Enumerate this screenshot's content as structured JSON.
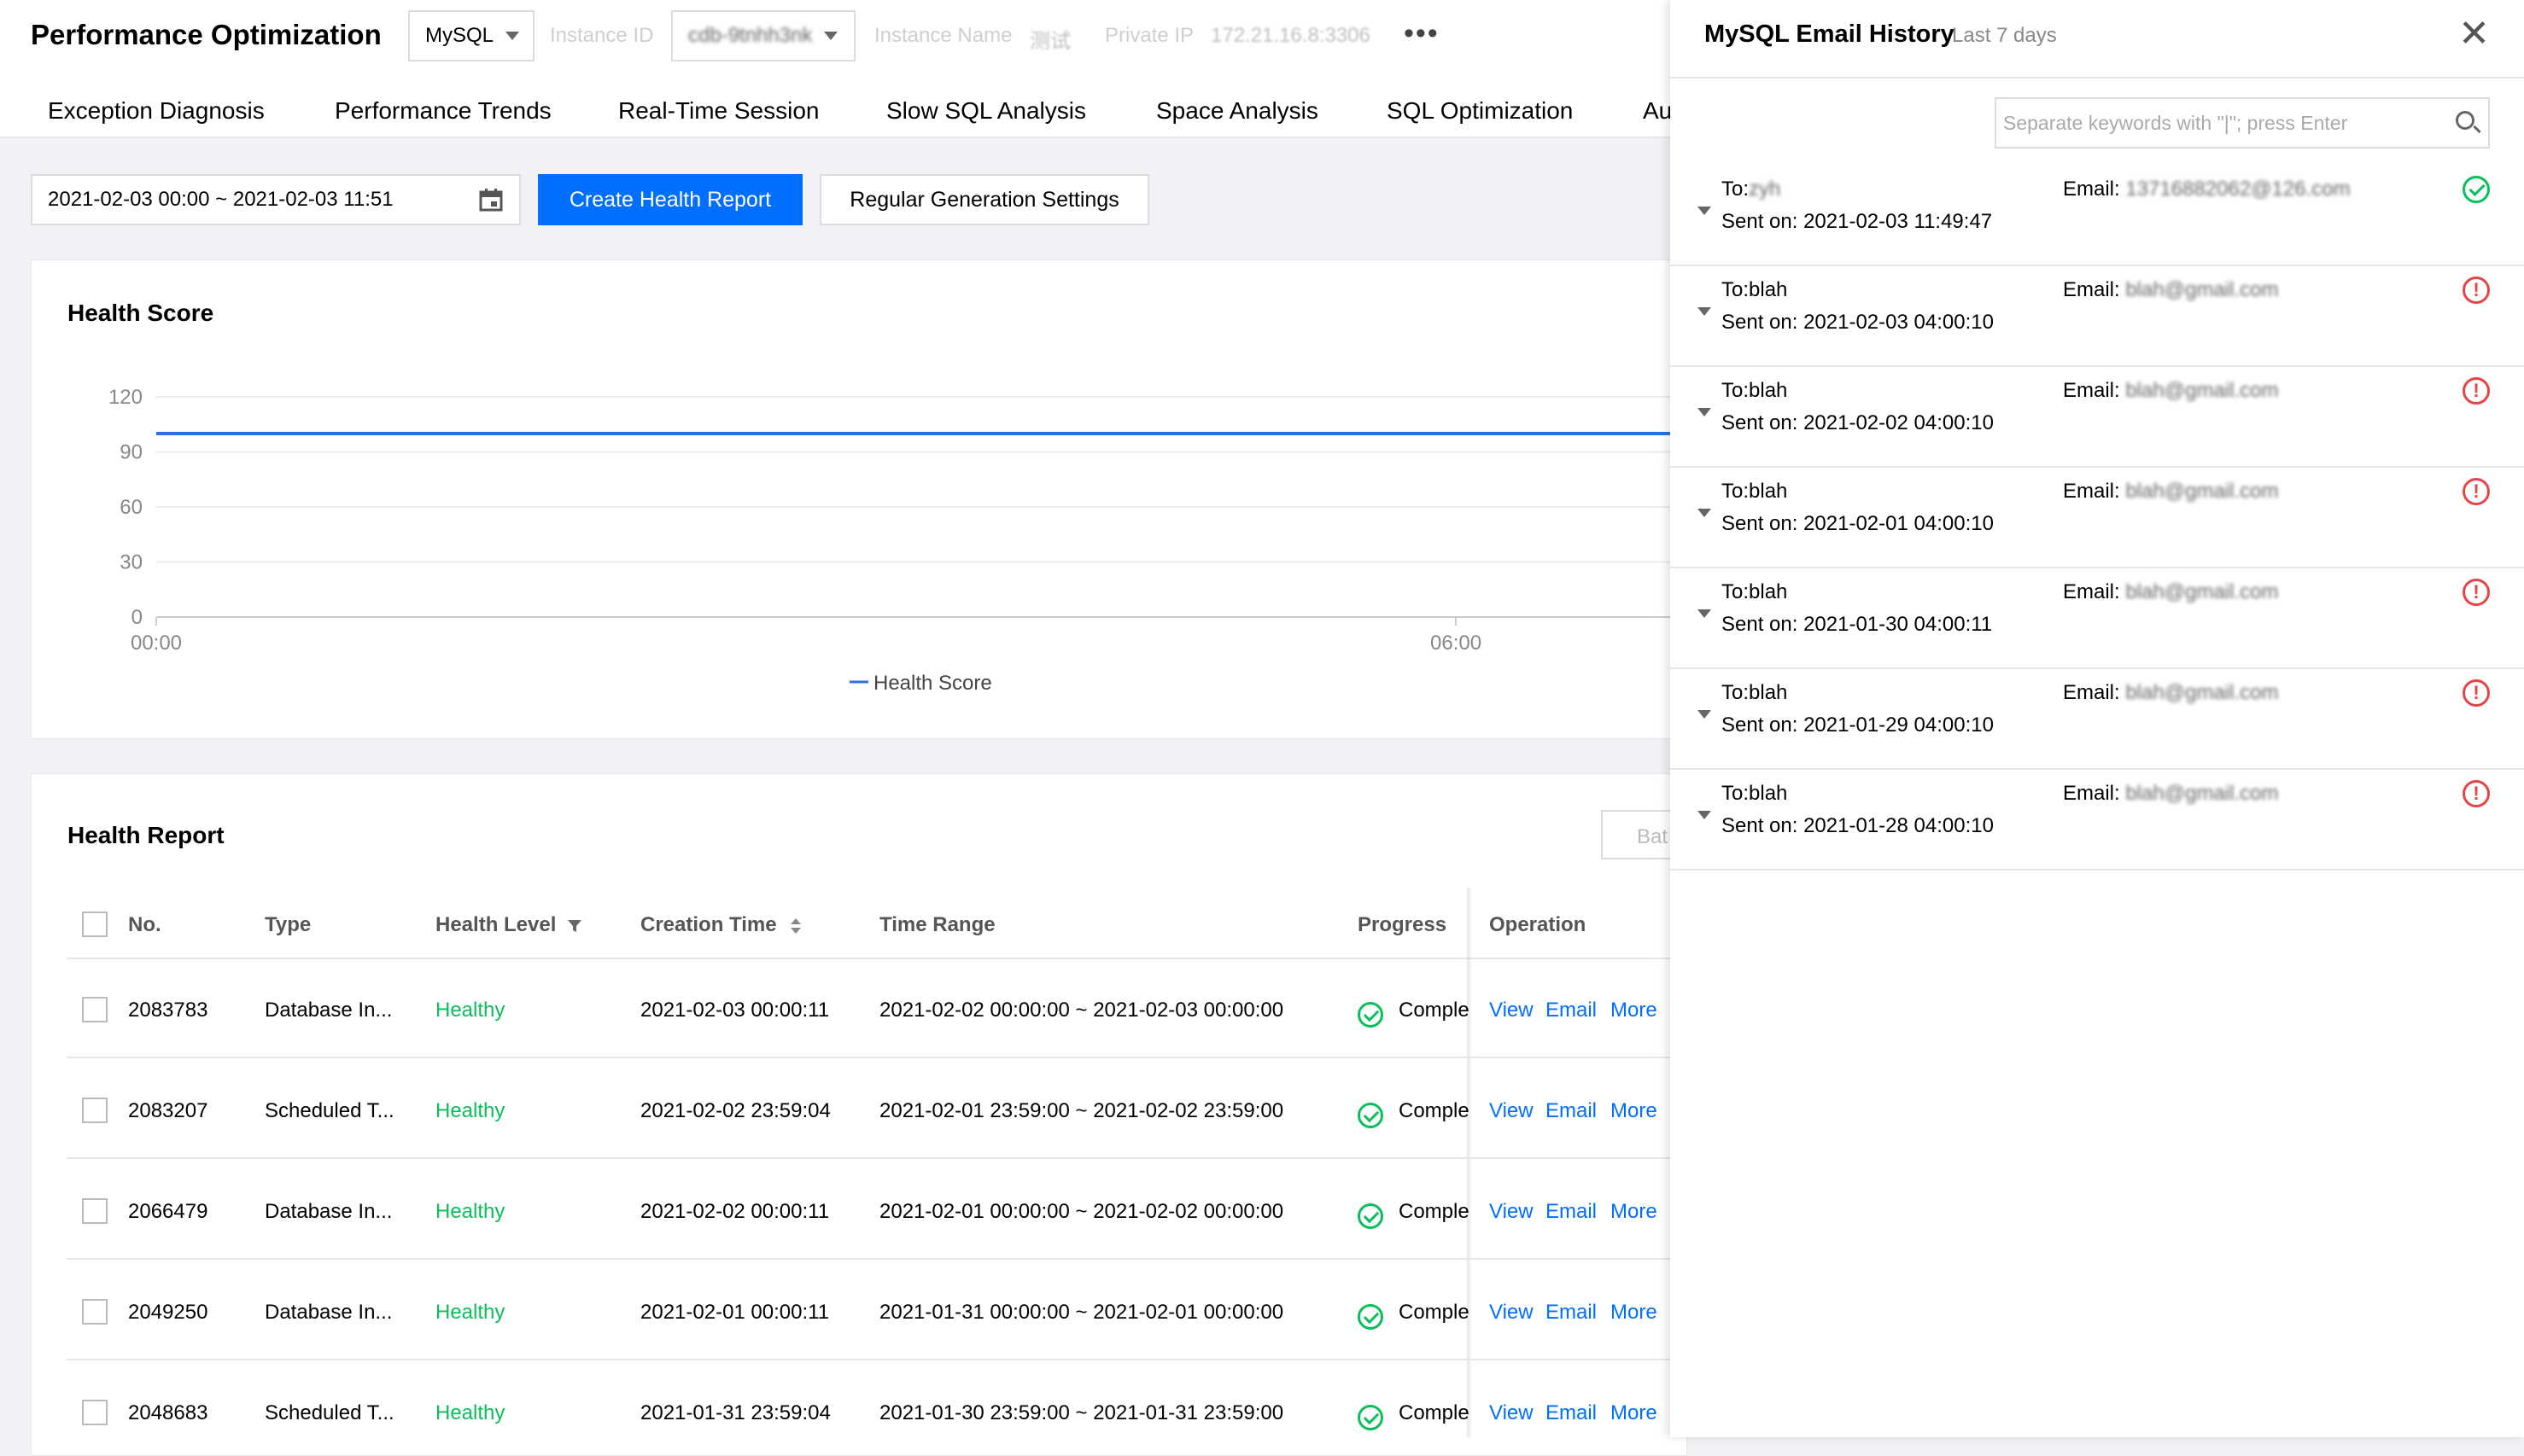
{
  "app": {
    "title": "Performance Optimization",
    "db_type": "MySQL",
    "instance_id_label": "Instance ID",
    "instance_id": "cdb-9tnhh3nk",
    "instance_name_label": "Instance Name",
    "instance_name": "测试",
    "private_ip_label": "Private IP",
    "private_ip": "172.21.16.8:3306",
    "more": "•••"
  },
  "tabs": [
    {
      "label": "Exception Diagnosis"
    },
    {
      "label": "Performance Trends"
    },
    {
      "label": "Real-Time Session"
    },
    {
      "label": "Slow SQL Analysis"
    },
    {
      "label": "Space Analysis"
    },
    {
      "label": "SQL Optimization"
    },
    {
      "label": "Au"
    }
  ],
  "toolbar": {
    "date_range": "2021-02-03 00:00 ~ 2021-02-03 11:51",
    "create_button": "Create Health Report",
    "settings_button": "Regular Generation Settings"
  },
  "health_score": {
    "title": "Health Score",
    "legend": "Health Score"
  },
  "chart_data": {
    "type": "line",
    "title": "Health Score",
    "y_ticks": [
      "120",
      "90",
      "60",
      "30",
      "0"
    ],
    "x_ticks": [
      "00:00",
      "06:00"
    ],
    "ylim": [
      0,
      120
    ],
    "series": [
      {
        "name": "Health Score",
        "x": [
          "00:00",
          "06:00",
          "11:51"
        ],
        "values": [
          100,
          100,
          100
        ]
      }
    ],
    "colors": {
      "series": "#2f6fe0"
    },
    "grid": true,
    "legend_position": "bottom"
  },
  "report": {
    "title": "Health Report",
    "batch_button": "Bat",
    "columns": [
      "No.",
      "Type",
      "Health Level",
      "Creation Time",
      "Time Range",
      "Progress",
      "Operation"
    ],
    "rows": [
      {
        "no": "2083783",
        "type": "Database In...",
        "level": "Healthy",
        "created": "2021-02-03 00:00:11",
        "range": "2021-02-02 00:00:00 ~ 2021-02-03 00:00:00",
        "progress": "Comple",
        "view": "View",
        "email": "Email",
        "more": "More"
      },
      {
        "no": "2083207",
        "type": "Scheduled T...",
        "level": "Healthy",
        "created": "2021-02-02 23:59:04",
        "range": "2021-02-01 23:59:00 ~ 2021-02-02 23:59:00",
        "progress": "Comple",
        "view": "View",
        "email": "Email",
        "more": "More"
      },
      {
        "no": "2066479",
        "type": "Database In...",
        "level": "Healthy",
        "created": "2021-02-02 00:00:11",
        "range": "2021-02-01 00:00:00 ~ 2021-02-02 00:00:00",
        "progress": "Comple",
        "view": "View",
        "email": "Email",
        "more": "More"
      },
      {
        "no": "2049250",
        "type": "Database In...",
        "level": "Healthy",
        "created": "2021-02-01 00:00:11",
        "range": "2021-01-31 00:00:00 ~ 2021-02-01 00:00:00",
        "progress": "Comple",
        "view": "View",
        "email": "Email",
        "more": "More"
      },
      {
        "no": "2048683",
        "type": "Scheduled T...",
        "level": "Healthy",
        "created": "2021-01-31 23:59:04",
        "range": "2021-01-30 23:59:00 ~ 2021-01-31 23:59:00",
        "progress": "Comple",
        "view": "View",
        "email": "Email",
        "more": "More"
      }
    ]
  },
  "drawer": {
    "title": "MySQL Email History",
    "subtitle": "Last 7 days",
    "close": "✕",
    "search_placeholder": "Separate keywords with \"|\"; press Enter",
    "items": [
      {
        "to_label": "To:",
        "to": "zyh",
        "sent": "Sent on: 2021-02-03 11:49:47",
        "email_label": "Email: ",
        "email": "13716882062@126.com",
        "status": "success"
      },
      {
        "to_label": "To:",
        "to": "blah",
        "sent": "Sent on: 2021-02-03 04:00:10",
        "email_label": "Email: ",
        "email": "blah@gmail.com",
        "status": "error"
      },
      {
        "to_label": "To:",
        "to": "blah",
        "sent": "Sent on: 2021-02-02 04:00:10",
        "email_label": "Email: ",
        "email": "blah@gmail.com",
        "status": "error"
      },
      {
        "to_label": "To:",
        "to": "blah",
        "sent": "Sent on: 2021-02-01 04:00:10",
        "email_label": "Email: ",
        "email": "blah@gmail.com",
        "status": "error"
      },
      {
        "to_label": "To:",
        "to": "blah",
        "sent": "Sent on: 2021-01-30 04:00:11",
        "email_label": "Email: ",
        "email": "blah@gmail.com",
        "status": "error"
      },
      {
        "to_label": "To:",
        "to": "blah",
        "sent": "Sent on: 2021-01-29 04:00:10",
        "email_label": "Email: ",
        "email": "blah@gmail.com",
        "status": "error"
      },
      {
        "to_label": "To:",
        "to": "blah",
        "sent": "Sent on: 2021-01-28 04:00:10",
        "email_label": "Email: ",
        "email": "blah@gmail.com",
        "status": "error"
      }
    ]
  }
}
